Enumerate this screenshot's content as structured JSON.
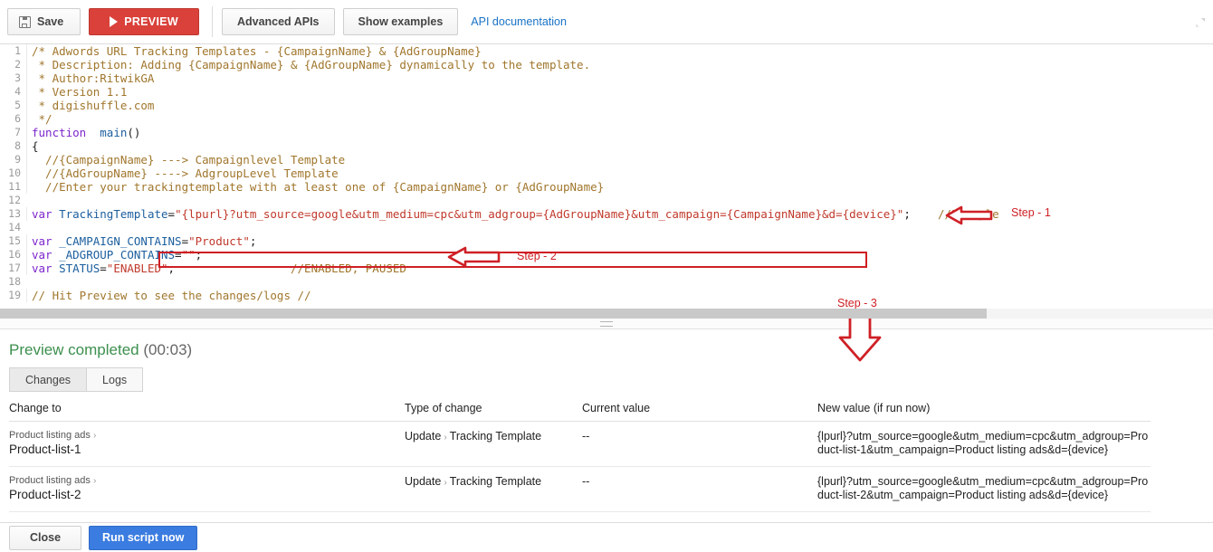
{
  "toolbar": {
    "save_label": "Save",
    "save_icon": "floppy-disk-icon",
    "preview_label": "PREVIEW",
    "preview_icon": "play-icon",
    "advanced_apis_label": "Advanced APIs",
    "show_examples_label": "Show examples",
    "api_documentation_label": "API documentation",
    "expand_icon": "expand-corner-icon",
    "accent_red": "#d9413a",
    "link_blue": "#1a73c7"
  },
  "editor": {
    "lines": [
      {
        "n": "1",
        "tokens": [
          {
            "t": "com",
            "v": "/* Adwords URL Tracking Templates - {CampaignName} & {AdGroupName}"
          }
        ]
      },
      {
        "n": "2",
        "tokens": [
          {
            "t": "com",
            "v": " * Description: Adding {CampaignName} & {AdGroupName} dynamically to the template."
          }
        ]
      },
      {
        "n": "3",
        "tokens": [
          {
            "t": "com",
            "v": " * Author:RitwikGA"
          }
        ]
      },
      {
        "n": "4",
        "tokens": [
          {
            "t": "com",
            "v": " * Version 1.1"
          }
        ]
      },
      {
        "n": "5",
        "tokens": [
          {
            "t": "com",
            "v": " * digishuffle.com"
          }
        ]
      },
      {
        "n": "6",
        "tokens": [
          {
            "t": "com",
            "v": " */"
          }
        ]
      },
      {
        "n": "7",
        "tokens": [
          {
            "t": "kw",
            "v": "function"
          },
          {
            "t": "pln",
            "v": "  "
          },
          {
            "t": "var",
            "v": "main"
          },
          {
            "t": "pln",
            "v": "()"
          }
        ]
      },
      {
        "n": "8",
        "tokens": [
          {
            "t": "pln",
            "v": "{"
          }
        ]
      },
      {
        "n": "9",
        "tokens": [
          {
            "t": "com",
            "v": "  //{CampaignName} ---> Campaignlevel Template"
          }
        ]
      },
      {
        "n": "10",
        "tokens": [
          {
            "t": "com",
            "v": "  //{AdGroupName} ----> AdgroupLevel Template"
          }
        ]
      },
      {
        "n": "11",
        "tokens": [
          {
            "t": "com",
            "v": "  //Enter your trackingtemplate with at least one of {CampaignName} or {AdGroupName}"
          }
        ]
      },
      {
        "n": "12",
        "tokens": [
          {
            "t": "pln",
            "v": ""
          }
        ]
      },
      {
        "n": "13",
        "tokens": [
          {
            "t": "kw",
            "v": "var"
          },
          {
            "t": "pln",
            "v": " "
          },
          {
            "t": "var",
            "v": "TrackingTemplate"
          },
          {
            "t": "pln",
            "v": "="
          },
          {
            "t": "str",
            "v": "\"{lpurl}?utm_source=google&utm_medium=cpc&utm_adgroup={AdGroupName}&utm_campaign={CampaignName}&d={device}\""
          },
          {
            "t": "pln",
            "v": ";"
          },
          {
            "t": "pln",
            "v": "    "
          },
          {
            "t": "com",
            "v": "//Example"
          }
        ]
      },
      {
        "n": "14",
        "tokens": [
          {
            "t": "pln",
            "v": ""
          }
        ]
      },
      {
        "n": "15",
        "tokens": [
          {
            "t": "kw",
            "v": "var"
          },
          {
            "t": "pln",
            "v": " "
          },
          {
            "t": "var",
            "v": "_CAMPAIGN_CONTAINS"
          },
          {
            "t": "pln",
            "v": "="
          },
          {
            "t": "str",
            "v": "\"Product\""
          },
          {
            "t": "pln",
            "v": ";"
          }
        ]
      },
      {
        "n": "16",
        "tokens": [
          {
            "t": "kw",
            "v": "var"
          },
          {
            "t": "pln",
            "v": " "
          },
          {
            "t": "var",
            "v": "_ADGROUP_CONTAINS"
          },
          {
            "t": "pln",
            "v": "="
          },
          {
            "t": "str",
            "v": "\"\""
          },
          {
            "t": "pln",
            "v": ";"
          }
        ]
      },
      {
        "n": "17",
        "tokens": [
          {
            "t": "kw",
            "v": "var"
          },
          {
            "t": "pln",
            "v": " "
          },
          {
            "t": "var",
            "v": "STATUS"
          },
          {
            "t": "pln",
            "v": "="
          },
          {
            "t": "str",
            "v": "\"ENABLED\""
          },
          {
            "t": "pln",
            "v": ";"
          },
          {
            "t": "pln",
            "v": "                 "
          },
          {
            "t": "com",
            "v": "//ENABLED, PAUSED"
          }
        ]
      },
      {
        "n": "18",
        "tokens": [
          {
            "t": "pln",
            "v": ""
          }
        ]
      },
      {
        "n": "19",
        "tokens": [
          {
            "t": "com",
            "v": "// Hit Preview to see the changes/logs //"
          }
        ]
      }
    ]
  },
  "annotations": {
    "color": "#cf2026",
    "step1_label": "Step - 1",
    "step2_label": "Step - 2",
    "step3_label": "Step - 3",
    "arrow1_icon": "arrow-left-icon",
    "arrow2_icon": "arrow-left-icon",
    "arrow3_icon": "arrow-down-icon",
    "highlight1_icon": "highlight-box-icon",
    "highlight2_icon": "highlight-box-icon"
  },
  "results": {
    "status_main": "Preview completed",
    "status_time": "(00:03)",
    "status_color": "#3c8f4e",
    "tabs": [
      {
        "label": "Changes",
        "active": true
      },
      {
        "label": "Logs",
        "active": false
      }
    ],
    "columns": [
      "Change to",
      "Type of change",
      "Current value",
      "New value (if run now)"
    ],
    "rows": [
      {
        "crumb": "Product listing ads",
        "crumb_chevron": "›",
        "name": "Product-list-1",
        "type_action": "Update",
        "type_chevron": "›",
        "type_target": "Tracking Template",
        "current_value": "--",
        "new_value": "{lpurl}?utm_source=google&utm_medium=cpc&utm_adgroup=Product-list-1&utm_campaign=Product listing ads&d={device}"
      },
      {
        "crumb": "Product listing ads",
        "crumb_chevron": "›",
        "name": "Product-list-2",
        "type_action": "Update",
        "type_chevron": "›",
        "type_target": "Tracking Template",
        "current_value": "--",
        "new_value": "{lpurl}?utm_source=google&utm_medium=cpc&utm_adgroup=Product-list-2&utm_campaign=Product listing ads&d={device}"
      }
    ]
  },
  "footer": {
    "close_label": "Close",
    "run_label": "Run script now",
    "primary_blue": "#3b7ce0"
  },
  "scrollbar": {
    "thumb_width_px": "1090"
  }
}
